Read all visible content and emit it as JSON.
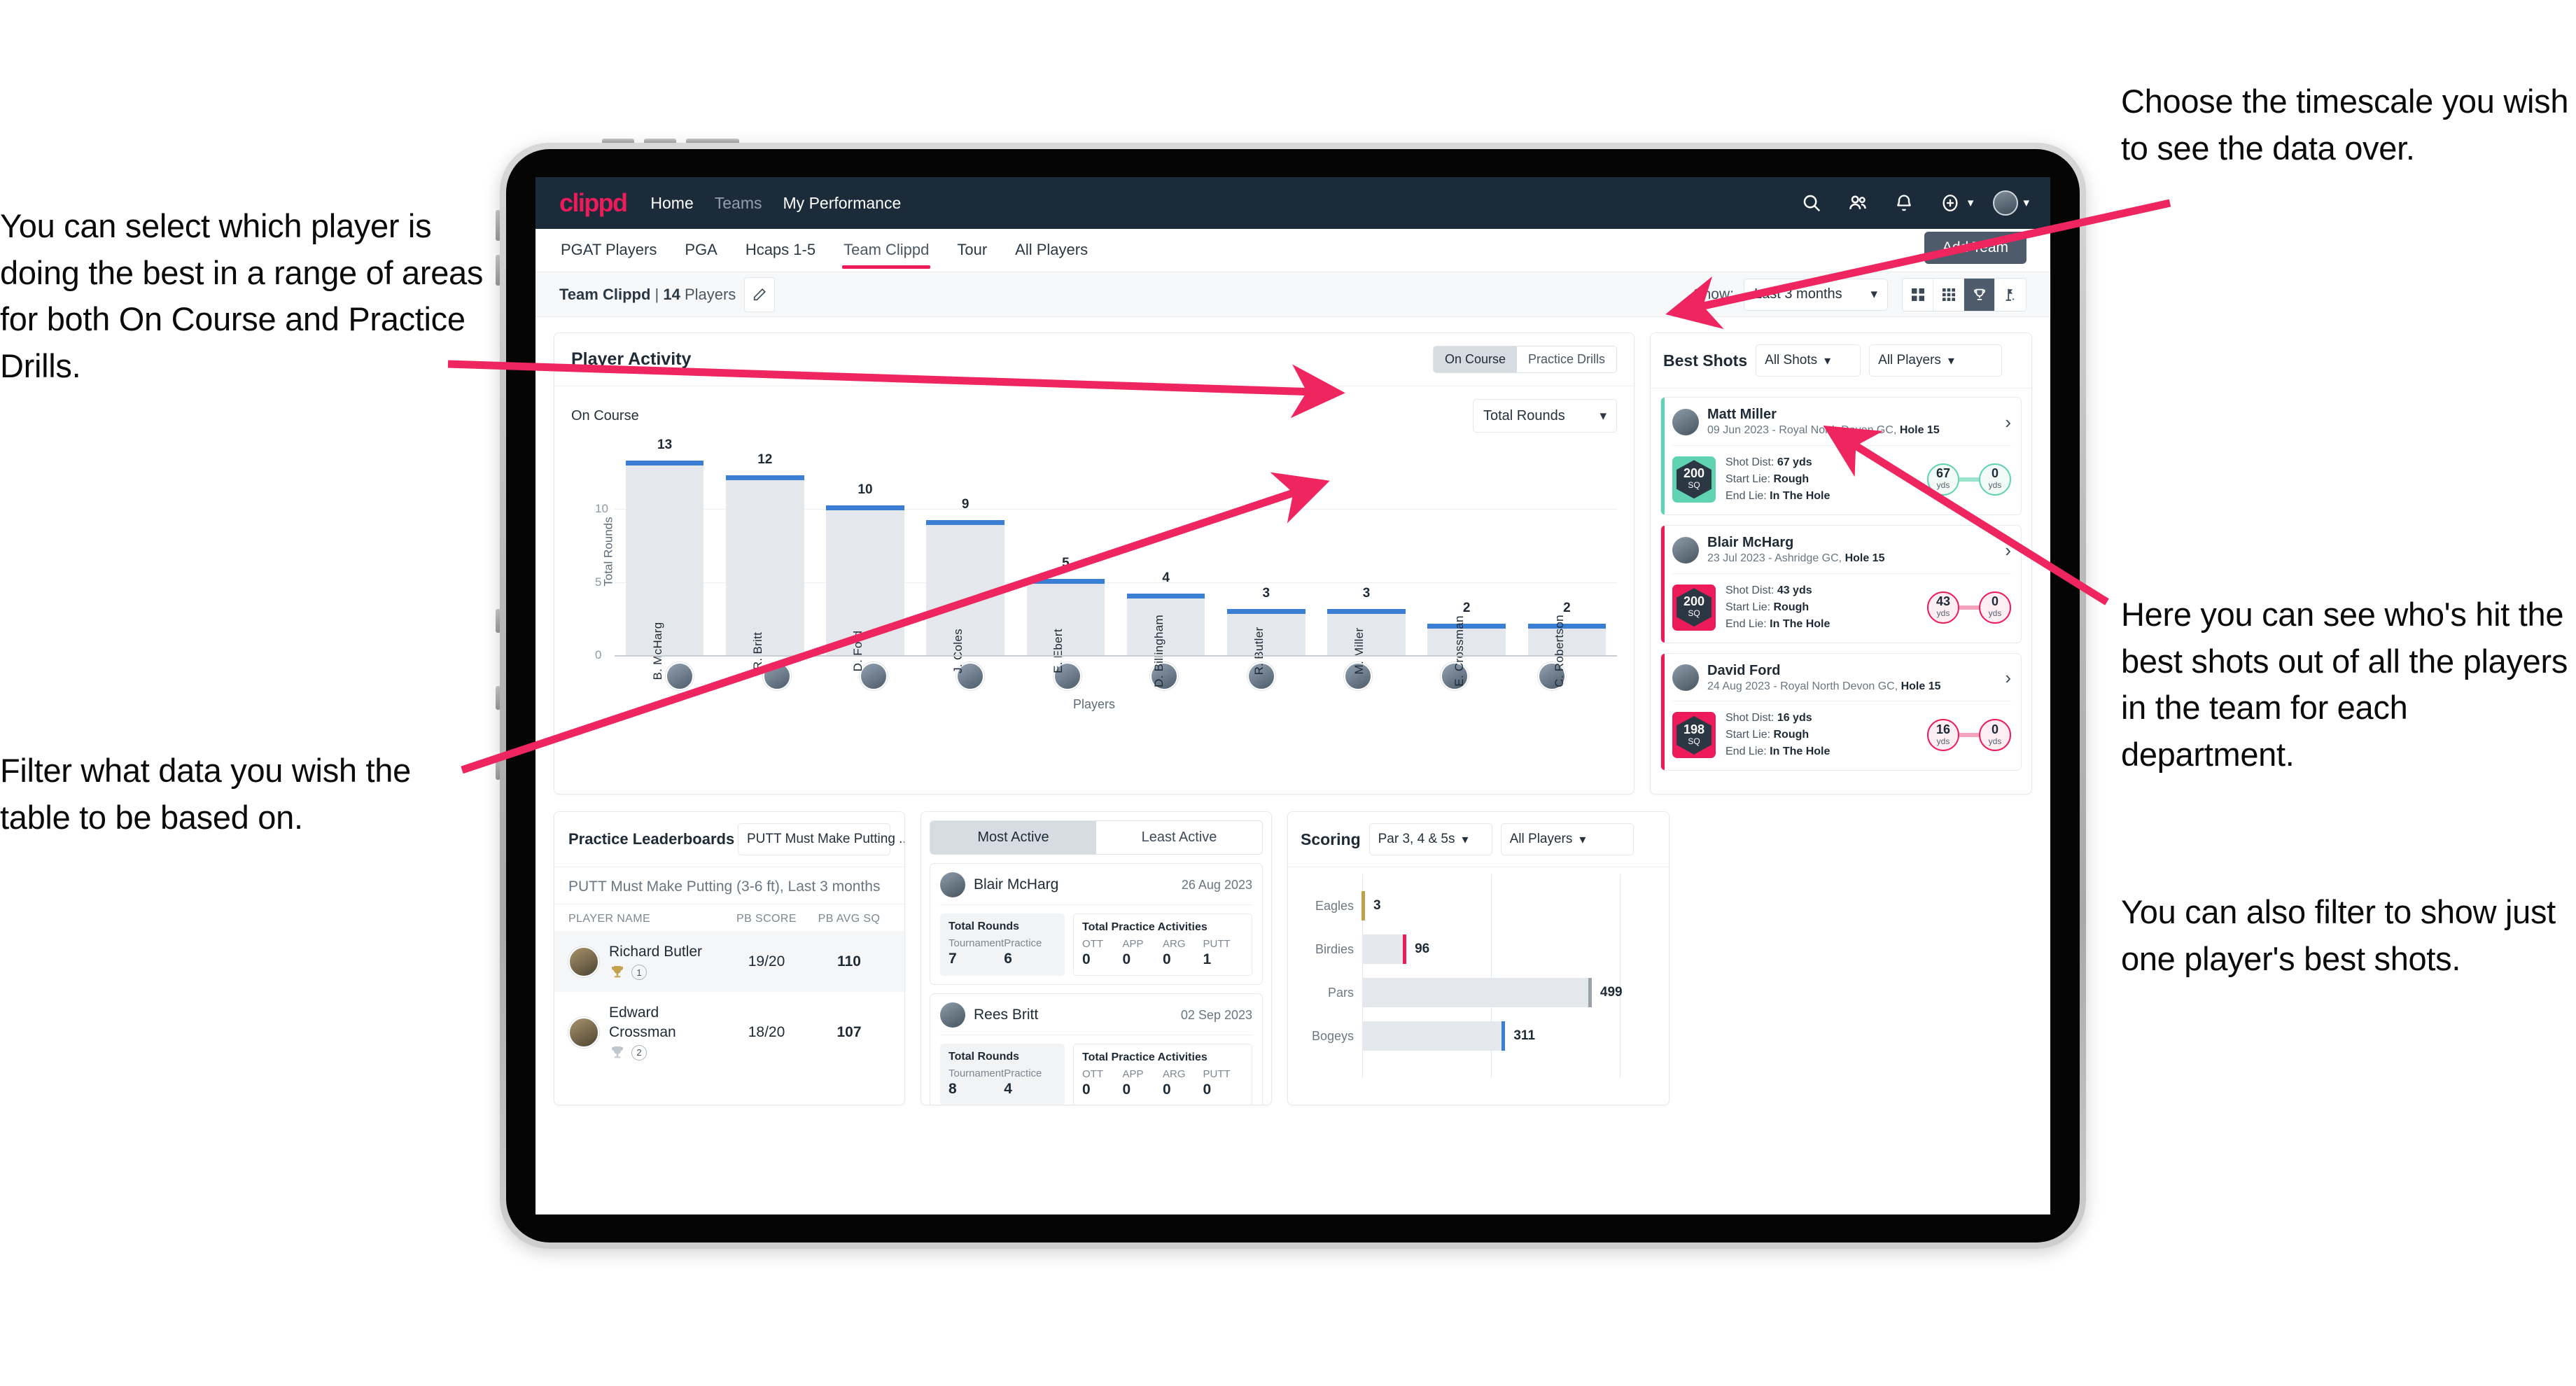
{
  "annotations": {
    "left_top": "You can select which player is doing the best in a range of areas for both On Course and Practice Drills.",
    "left_bottom": "Filter what data you wish the table to be based on.",
    "right_top": "Choose the timescale you wish to see the data over.",
    "right_middle": "Here you can see who's hit the best shots out of all the players in the team for each department.",
    "right_bottom": "You can also filter to show just one player's best shots."
  },
  "nav": {
    "logo": "clippd",
    "links": [
      {
        "label": "Home",
        "active": true
      },
      {
        "label": "Teams",
        "active": false
      },
      {
        "label": "My Performance",
        "active": true
      }
    ],
    "icons": [
      "search-icon",
      "people-icon",
      "bell-icon",
      "plus-circle-icon"
    ]
  },
  "tabs": [
    {
      "label": "PGAT Players",
      "active": false
    },
    {
      "label": "PGA",
      "active": false
    },
    {
      "label": "Hcaps 1-5",
      "active": false
    },
    {
      "label": "Team Clippd",
      "active": true
    },
    {
      "label": "Tour",
      "active": false
    },
    {
      "label": "All Players",
      "active": false
    }
  ],
  "add_team_label": "Add Team",
  "subheader": {
    "team_name": "Team Clippd",
    "separator": " | ",
    "player_count": "14",
    "players_word": " Players",
    "show_label": "Show:",
    "timescale_value": "Last 3 months",
    "view_buttons": [
      "grid-2x2-icon",
      "grid-3x3-icon",
      "trophy-icon",
      "golf-flag-icon"
    ],
    "view_active_index": 2
  },
  "player_activity": {
    "title": "Player Activity",
    "segments": [
      {
        "label": "On Course",
        "active": true
      },
      {
        "label": "Practice Drills",
        "active": false
      }
    ],
    "chart_subtitle": "On Course",
    "metric_select": "Total Rounds"
  },
  "chart_data": {
    "type": "bar",
    "title": "Player Activity",
    "xlabel": "Players",
    "ylabel": "Total Rounds",
    "ylim": [
      0,
      14
    ],
    "yticks": [
      0,
      5,
      10
    ],
    "grid": true,
    "categories": [
      "B. McHarg",
      "R. Britt",
      "D. Ford",
      "J. Coles",
      "E. Ebert",
      "D. Billingham",
      "R. Butler",
      "M. Miller",
      "E. Crossman",
      "C. Robertson"
    ],
    "values": [
      13,
      12,
      10,
      9,
      5,
      4,
      3,
      3,
      2,
      2
    ],
    "bar_color": "#e4e7eb",
    "cap_color": "#3b7fd4"
  },
  "best_shots": {
    "title": "Best Shots",
    "shot_filter": "All Shots",
    "player_filter": "All Players",
    "items": [
      {
        "player": "Matt Miller",
        "meta_prefix": "09 Jun 2023 - Royal North Devon GC, ",
        "meta_hole": "Hole 15",
        "badge_value": "200",
        "badge_unit": "SQ",
        "shot_dist_label": "Shot Dist: ",
        "shot_dist": "67 yds",
        "start_lie_label": "Start Lie: ",
        "start_lie": "Rough",
        "end_lie_label": "End Lie: ",
        "end_lie": "In The Hole",
        "from_value": "67",
        "from_unit": "yds",
        "to_value": "0",
        "to_unit": "yds",
        "accent": "teal"
      },
      {
        "player": "Blair McHarg",
        "meta_prefix": "23 Jul 2023 - Ashridge GC, ",
        "meta_hole": "Hole 15",
        "badge_value": "200",
        "badge_unit": "SQ",
        "shot_dist_label": "Shot Dist: ",
        "shot_dist": "43 yds",
        "start_lie_label": "Start Lie: ",
        "start_lie": "Rough",
        "end_lie_label": "End Lie: ",
        "end_lie": "In The Hole",
        "from_value": "43",
        "from_unit": "yds",
        "to_value": "0",
        "to_unit": "yds",
        "accent": "pink"
      },
      {
        "player": "David Ford",
        "meta_prefix": "24 Aug 2023 - Royal North Devon GC, ",
        "meta_hole": "Hole 15",
        "badge_value": "198",
        "badge_unit": "SQ",
        "shot_dist_label": "Shot Dist: ",
        "shot_dist": "16 yds",
        "start_lie_label": "Start Lie: ",
        "start_lie": "Rough",
        "end_lie_label": "End Lie: ",
        "end_lie": "In The Hole",
        "from_value": "16",
        "from_unit": "yds",
        "to_value": "0",
        "to_unit": "yds",
        "accent": "pink"
      }
    ]
  },
  "practice_leaderboards": {
    "title": "Practice Leaderboards",
    "drill_select": "PUTT Must Make Putting ...",
    "subtitle_bold": "PUTT Must Make Putting (3-6 ft),",
    "subtitle_light": " Last 3 months",
    "columns": [
      "PLAYER NAME",
      "PB SCORE",
      "PB AVG SQ"
    ],
    "rows": [
      {
        "name": "Richard Butler",
        "rank": "1",
        "trophy": "gold",
        "pb_score": "19/20",
        "pb_avg_sq": "110"
      },
      {
        "name": "Edward Crossman",
        "rank": "2",
        "trophy": "silver",
        "pb_score": "18/20",
        "pb_avg_sq": "107"
      }
    ]
  },
  "activity": {
    "tabs": [
      {
        "label": "Most Active",
        "active": true
      },
      {
        "label": "Least Active",
        "active": false
      }
    ],
    "cards": [
      {
        "player": "Blair McHarg",
        "date": "26 Aug 2023",
        "rounds_title": "Total Rounds",
        "rounds_labels": [
          "Tournament",
          "Practice"
        ],
        "rounds_values": [
          "7",
          "6"
        ],
        "practice_title": "Total Practice Activities",
        "practice_labels": [
          "OTT",
          "APP",
          "ARG",
          "PUTT"
        ],
        "practice_values": [
          "0",
          "0",
          "0",
          "1"
        ]
      },
      {
        "player": "Rees Britt",
        "date": "02 Sep 2023",
        "rounds_title": "Total Rounds",
        "rounds_labels": [
          "Tournament",
          "Practice"
        ],
        "rounds_values": [
          "8",
          "4"
        ],
        "practice_title": "Total Practice Activities",
        "practice_labels": [
          "OTT",
          "APP",
          "ARG",
          "PUTT"
        ],
        "practice_values": [
          "0",
          "0",
          "0",
          "0"
        ]
      }
    ]
  },
  "scoring": {
    "title": "Scoring",
    "par_filter": "Par 3, 4 & 5s",
    "player_filter": "All Players",
    "chart": {
      "type": "bar",
      "orientation": "horizontal",
      "categories": [
        "Eagles",
        "Birdies",
        "Pars",
        "Bogeys"
      ],
      "values": [
        3,
        96,
        499,
        311
      ],
      "colors": [
        "#c3a04a",
        "#ed1b5a",
        "#9aa3ac",
        "#3b7fd4"
      ],
      "xmax": 560
    }
  }
}
